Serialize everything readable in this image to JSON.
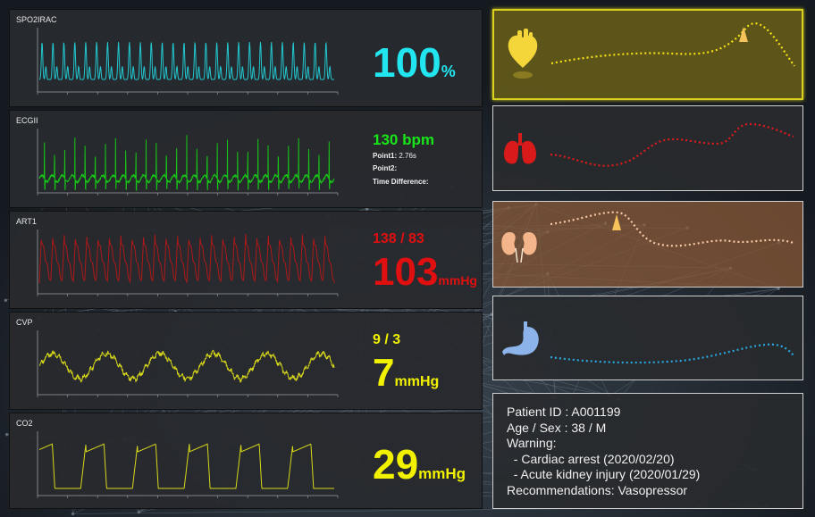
{
  "panels": [
    {
      "id": "spo2",
      "title": "SPO2IRAC",
      "value": "100",
      "unit": "%",
      "color": "#21e6f0",
      "trace_color": "#22c8d0"
    },
    {
      "id": "ecg",
      "title": "ECGII",
      "value": "130 bpm",
      "color": "#19e619",
      "trace_color": "#17c417",
      "point1_label": "Point1:",
      "point1_value": "2.76s",
      "point2_label": "Point2:",
      "time_diff_label": "Time Difference:"
    },
    {
      "id": "art",
      "title": "ART1",
      "value_sub": "138 / 83",
      "value": "103",
      "unit": "mmHg",
      "color": "#e01010",
      "trace_color": "#b01818"
    },
    {
      "id": "cvp",
      "title": "CVP",
      "value_sub": "9 / 3",
      "value": "7",
      "unit": "mmHg",
      "color": "#f2f200",
      "trace_color": "#d8d81a"
    },
    {
      "id": "co2",
      "title": "CO2",
      "value": "29",
      "unit": "mmHg",
      "color": "#f2f200",
      "trace_color": "#d8d81a"
    }
  ],
  "organs": [
    {
      "name": "heart",
      "icon": "heart-icon",
      "color": "#f5e017",
      "highlighted": true,
      "alert": true
    },
    {
      "name": "lungs",
      "icon": "lungs-icon",
      "color": "#e01a1a",
      "highlighted": false,
      "alert": false
    },
    {
      "name": "kidney",
      "icon": "kidney-icon",
      "color": "#f4b58a",
      "highlighted": true,
      "alert": true
    },
    {
      "name": "stomach",
      "icon": "stomach-icon",
      "color": "#2aa8e0",
      "highlighted": false,
      "alert": false
    }
  ],
  "patient": {
    "id_line": "Patient ID : A001199",
    "age_sex_line": "Age / Sex : 38 / M",
    "warning_label": "Warning:",
    "warnings": [
      "  - Cardiac arrest (2020/02/20)",
      "  - Acute kidney injury (2020/01/29)"
    ],
    "recommendation_line": "Recommendations: Vasopressor"
  }
}
